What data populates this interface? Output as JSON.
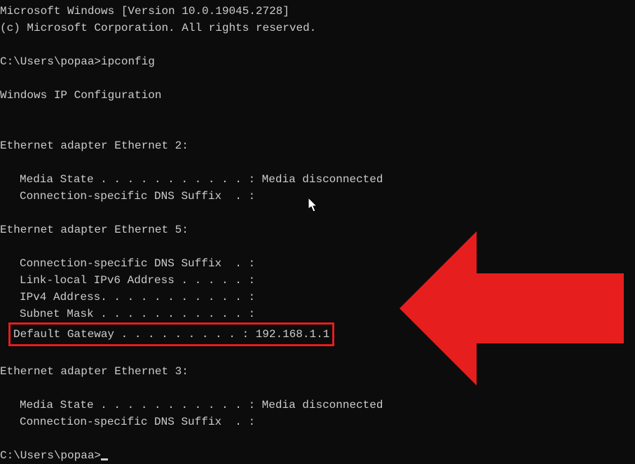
{
  "header": {
    "version_line": "Microsoft Windows [Version 10.0.19045.2728]",
    "copyright_line": "(c) Microsoft Corporation. All rights reserved."
  },
  "prompt1": {
    "path": "C:\\Users\\popaa>",
    "command": "ipconfig"
  },
  "config_header": "Windows IP Configuration",
  "adapters": [
    {
      "title": "Ethernet adapter Ethernet 2:",
      "lines": [
        {
          "label": "Media State . . . . . . . . . . . : ",
          "value": "Media disconnected"
        },
        {
          "label": "Connection-specific DNS Suffix  . :",
          "value": ""
        }
      ]
    },
    {
      "title": "Ethernet adapter Ethernet 5:",
      "lines": [
        {
          "label": "Connection-specific DNS Suffix  . :",
          "value": ""
        },
        {
          "label": "Link-local IPv6 Address . . . . . : ",
          "value": ""
        },
        {
          "label": "IPv4 Address. . . . . . . . . . . : ",
          "value": ""
        },
        {
          "label": "Subnet Mask . . . . . . . . . . . : ",
          "value": ""
        }
      ],
      "highlighted": {
        "label": "Default Gateway . . . . . . . . . : ",
        "value": "192.168.1.1"
      }
    },
    {
      "title": "Ethernet adapter Ethernet 3:",
      "lines": [
        {
          "label": "Media State . . . . . . . . . . . : ",
          "value": "Media disconnected"
        },
        {
          "label": "Connection-specific DNS Suffix  . :",
          "value": ""
        }
      ]
    }
  ],
  "prompt2": {
    "path": "C:\\Users\\popaa>"
  },
  "annotation": {
    "arrow_color": "#e61e1e",
    "highlight_color": "#e61e1e"
  }
}
